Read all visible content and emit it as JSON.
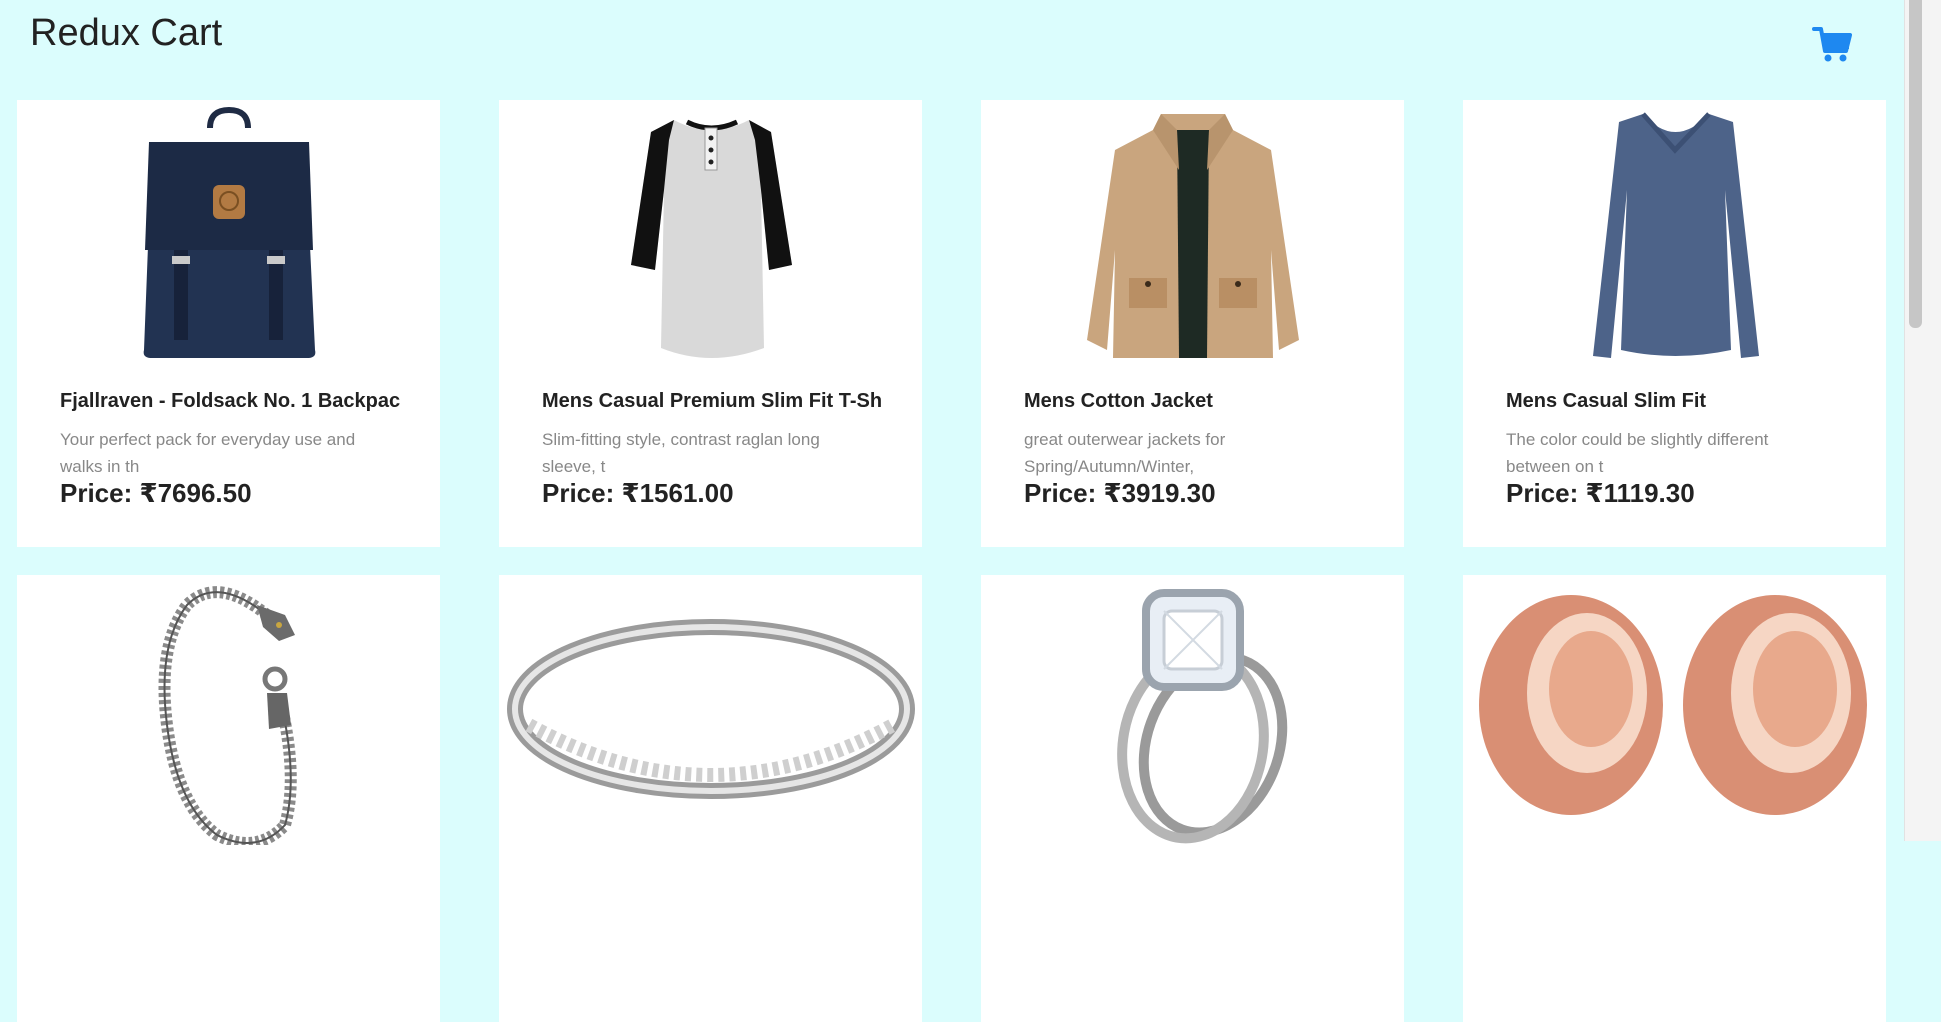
{
  "header": {
    "title": "Redux Cart",
    "cart_icon": "shopping-cart-icon",
    "accent": "#1e88f0"
  },
  "colors": {
    "background": "#dbfdfd",
    "card": "#ffffff"
  },
  "products": [
    {
      "name": "Fjallraven - Foldsack No. 1 Backpac...",
      "description": "Your perfect pack for everyday use and walks in th",
      "price": "Price: ₹7696.50",
      "image": "backpack-image"
    },
    {
      "name": "Mens Casual Premium Slim Fit T-Sh...",
      "description": "Slim-fitting style, contrast raglan long sleeve, t",
      "price": "Price: ₹1561.00",
      "image": "raglan-tshirt-image"
    },
    {
      "name": "Mens Cotton Jacket",
      "description": "great outerwear jackets for Spring/Autumn/Winter,",
      "price": "Price: ₹3919.30",
      "image": "cotton-jacket-image"
    },
    {
      "name": "Mens Casual Slim Fit",
      "description": "The color could be slightly different between on t",
      "price": "Price: ₹1119.30",
      "image": "long-sleeve-shirt-image"
    },
    {
      "name": "",
      "description": "",
      "price": "",
      "image": "dragon-bracelet-image"
    },
    {
      "name": "",
      "description": "",
      "price": "",
      "image": "silver-ring-image"
    },
    {
      "name": "",
      "description": "",
      "price": "",
      "image": "diamond-ring-image"
    },
    {
      "name": "",
      "description": "",
      "price": "",
      "image": "rose-gold-plugs-image"
    }
  ]
}
